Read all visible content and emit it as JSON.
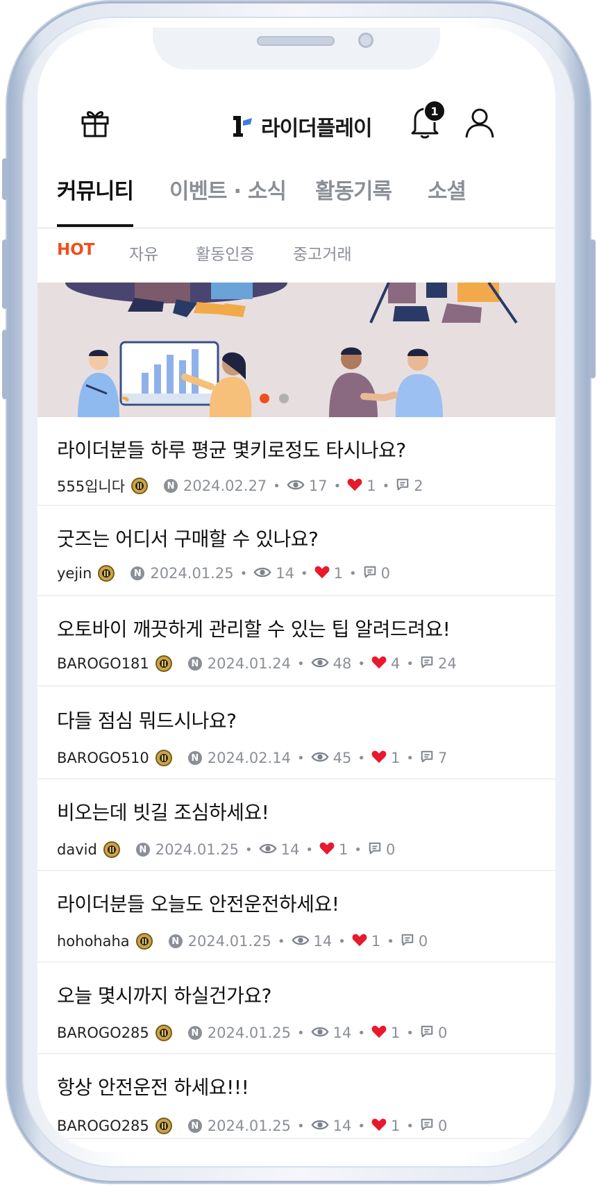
{
  "app": {
    "title": "라이더플레이",
    "notification_count": "1"
  },
  "icons": {
    "gift": "gift-icon",
    "bell": "bell-icon",
    "profile": "user-icon",
    "views": "eye-icon",
    "likes": "heart-icon",
    "comments": "comment-icon"
  },
  "colors": {
    "accent": "#f04e1c",
    "heart": "#e8192c",
    "text": "#111111",
    "muted": "#8b8f97"
  },
  "tabs": [
    {
      "label": "커뮤니티",
      "active": true
    },
    {
      "label": "이벤트 · 소식",
      "active": false
    },
    {
      "label": "활동기록",
      "active": false
    },
    {
      "label": "소셜",
      "active": false
    }
  ],
  "subtabs": [
    {
      "label": "HOT",
      "active": true
    },
    {
      "label": "자유",
      "active": false
    },
    {
      "label": "활동인증",
      "active": false
    },
    {
      "label": "중고거래",
      "active": false
    }
  ],
  "banner": {
    "slides": 2,
    "current": 1
  },
  "posts": [
    {
      "title": "라이더분들 하루 평균 몇키로정도 타시나요?",
      "author": "555입니다",
      "date": "2024.02.27",
      "views": "17",
      "likes": "1",
      "comments": "2"
    },
    {
      "title": "굿즈는 어디서 구매할 수 있나요?",
      "author": "yejin",
      "date": "2024.01.25",
      "views": "14",
      "likes": "1",
      "comments": "0"
    },
    {
      "title": "오토바이 깨끗하게 관리할 수 있는 팁 알려드려요!",
      "author": "BAROGO181",
      "date": "2024.01.24",
      "views": "48",
      "likes": "4",
      "comments": "24"
    },
    {
      "title": "다들 점심 뭐드시나요?",
      "author": "BAROGO510",
      "date": "2024.02.14",
      "views": "45",
      "likes": "1",
      "comments": "7"
    },
    {
      "title": "비오는데 빗길 조심하세요!",
      "author": "david",
      "date": "2024.01.25",
      "views": "14",
      "likes": "1",
      "comments": "0"
    },
    {
      "title": "라이더분들 오늘도 안전운전하세요!",
      "author": "hohohaha",
      "date": "2024.01.25",
      "views": "14",
      "likes": "1",
      "comments": "0"
    },
    {
      "title": "오늘 몇시까지 하실건가요?",
      "author": "BAROGO285",
      "date": "2024.01.25",
      "views": "14",
      "likes": "1",
      "comments": "0"
    },
    {
      "title": "항상 안전운전 하세요!!!",
      "author": "BAROGO285",
      "date": "2024.01.25",
      "views": "14",
      "likes": "1",
      "comments": "0"
    }
  ]
}
